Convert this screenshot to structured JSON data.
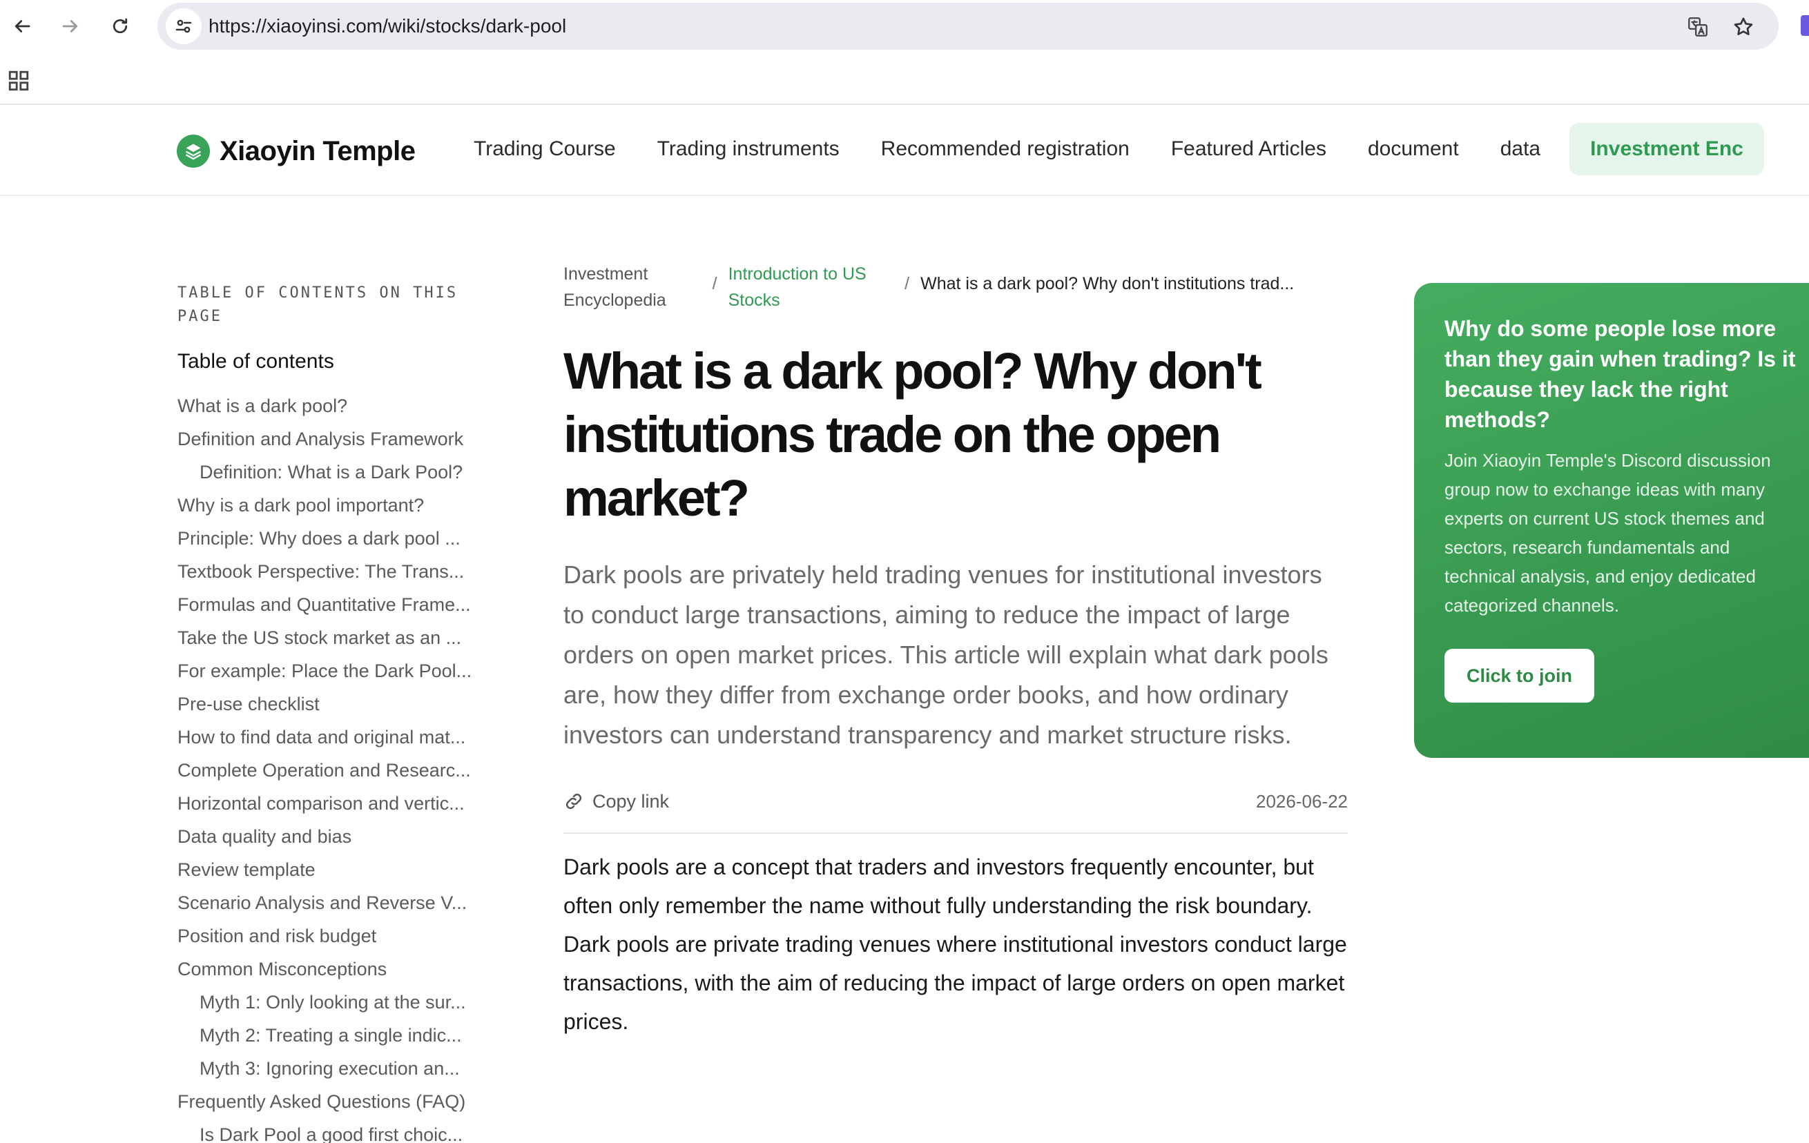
{
  "browser": {
    "url": "https://xiaoyinsi.com/wiki/stocks/dark-pool"
  },
  "site": {
    "name": "Xiaoyin Temple",
    "nav": [
      {
        "label": "Trading Course",
        "active": false
      },
      {
        "label": "Trading instruments",
        "active": false
      },
      {
        "label": "Recommended registration",
        "active": false
      },
      {
        "label": "Featured Articles",
        "active": false
      },
      {
        "label": "document",
        "active": false
      },
      {
        "label": "data",
        "active": false
      },
      {
        "label": "Investment Enc",
        "active": true
      }
    ],
    "accent_color": "#2f9a51"
  },
  "toc": {
    "kicker": "TABLE OF CONTENTS ON THIS PAGE",
    "title": "Table of contents",
    "items": [
      {
        "label": "What is a dark pool?",
        "sub": false
      },
      {
        "label": "Definition and Analysis Framework",
        "sub": false
      },
      {
        "label": "Definition: What is a Dark Pool?",
        "sub": true
      },
      {
        "label": "Why is a dark pool important?",
        "sub": false
      },
      {
        "label": "Principle: Why does a dark pool ...",
        "sub": false
      },
      {
        "label": "Textbook Perspective: The Trans...",
        "sub": false
      },
      {
        "label": "Formulas and Quantitative Frame...",
        "sub": false
      },
      {
        "label": "Take the US stock market as an ...",
        "sub": false
      },
      {
        "label": "For example: Place the Dark Pool...",
        "sub": false
      },
      {
        "label": "Pre-use checklist",
        "sub": false
      },
      {
        "label": "How to find data and original mat...",
        "sub": false
      },
      {
        "label": "Complete Operation and Researc...",
        "sub": false
      },
      {
        "label": "Horizontal comparison and vertic...",
        "sub": false
      },
      {
        "label": "Data quality and bias",
        "sub": false
      },
      {
        "label": "Review template",
        "sub": false
      },
      {
        "label": "Scenario Analysis and Reverse V...",
        "sub": false
      },
      {
        "label": "Position and risk budget",
        "sub": false
      },
      {
        "label": "Common Misconceptions",
        "sub": false
      },
      {
        "label": "Myth 1: Only looking at the sur...",
        "sub": true
      },
      {
        "label": "Myth 2: Treating a single indic...",
        "sub": true
      },
      {
        "label": "Myth 3: Ignoring execution an...",
        "sub": true
      },
      {
        "label": "Frequently Asked Questions (FAQ)",
        "sub": false
      },
      {
        "label": "Is Dark Pool a good first choic...",
        "sub": true
      }
    ]
  },
  "article": {
    "breadcrumb": [
      "Investment Encyclopedia",
      "Introduction to US Stocks",
      "What is a dark pool? Why don't institutions trad..."
    ],
    "breadcrumb_sep": "/",
    "title": "What is a dark pool? Why don't institutions trade on the open market?",
    "lede": "Dark pools are privately held trading venues for institutional investors to conduct large transactions, aiming to reduce the impact of large orders on open market prices. This article will explain what dark pools are, how they differ from exchange order books, and how ordinary investors can understand transparency and market structure risks.",
    "copy_link_label": "Copy link",
    "date": "2026-06-22",
    "body": "Dark pools are a concept that traders and investors frequently encounter, but often only remember the name without fully understanding the risk boundary. Dark pools are private trading venues where institutional investors conduct large transactions, with the aim of reducing the impact of large orders on open market prices."
  },
  "promo": {
    "title": "Why do some people lose more than they gain when trading? Is it because they lack the right methods?",
    "body": "Join Xiaoyin Temple's Discord discussion group now to exchange ideas with many experts on current US stock themes and sectors, research fundamentals and technical analysis, and enjoy dedicated categorized channels.",
    "button_label": "Click to join"
  }
}
